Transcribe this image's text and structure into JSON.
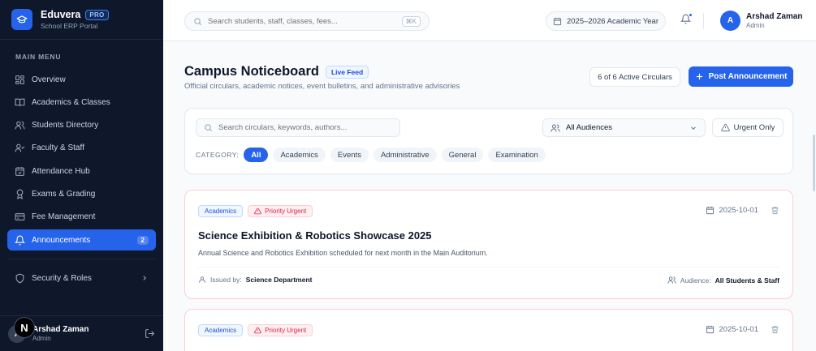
{
  "brand": {
    "name": "Eduvera",
    "badge": "PRO",
    "subtitle": "School ERP Portal"
  },
  "sidebar": {
    "heading": "MAIN MENU",
    "items": [
      {
        "label": "Overview",
        "icon": "grid-icon"
      },
      {
        "label": "Academics & Classes",
        "icon": "book-icon"
      },
      {
        "label": "Students Directory",
        "icon": "users-icon"
      },
      {
        "label": "Faculty & Staff",
        "icon": "user-check-icon"
      },
      {
        "label": "Attendance Hub",
        "icon": "calendar-check-icon"
      },
      {
        "label": "Exams & Grading",
        "icon": "award-icon"
      },
      {
        "label": "Fee Management",
        "icon": "credit-card-icon"
      },
      {
        "label": "Announcements",
        "icon": "bell-icon",
        "badge": "2",
        "active": true
      }
    ],
    "security": {
      "label": "Security & Roles",
      "icon": "shield-icon"
    },
    "user": {
      "initial": "A",
      "name": "Arshad Zaman",
      "role": "Admin"
    },
    "overlay_letter": "N"
  },
  "topbar": {
    "search_placeholder": "Search students, staff, classes, fees...",
    "shortcut": "⌘K",
    "academic_year": "2025–2026 Academic Year",
    "user": {
      "initial": "A",
      "name": "Arshad Zaman",
      "role": "Admin"
    }
  },
  "page": {
    "title": "Campus Noticeboard",
    "live_badge": "Live Feed",
    "subtitle": "Official circulars, academic notices, event bulletins, and administrative advisories",
    "active_count": "6 of 6 Active Circulars",
    "post_button": "Post Announcement"
  },
  "filters": {
    "search_placeholder": "Search circulars, keywords, authors...",
    "audience": "All Audiences",
    "urgent": "Urgent Only",
    "category_label": "CATEGORY:",
    "categories": [
      "All",
      "Academics",
      "Events",
      "Administrative",
      "General",
      "Examination"
    ],
    "active_category": "All"
  },
  "notices": [
    {
      "category": "Academics",
      "priority": "Priority Urgent",
      "date": "2025-10-01",
      "title": "Science Exhibition & Robotics Showcase 2025",
      "description": "Annual Science and Robotics Exhibition scheduled for next month in the Main Auditorium.",
      "issued_by_label": "Issued by:",
      "issued_by": "Science Department",
      "audience_label": "Audience:",
      "audience": "All Students & Staff"
    },
    {
      "category": "Academics",
      "priority": "Priority Urgent",
      "date": "2025-10-01"
    }
  ],
  "colors": {
    "accent": "#2563eb",
    "sidebar": "#0f172a",
    "urgent": "#e11d48"
  }
}
